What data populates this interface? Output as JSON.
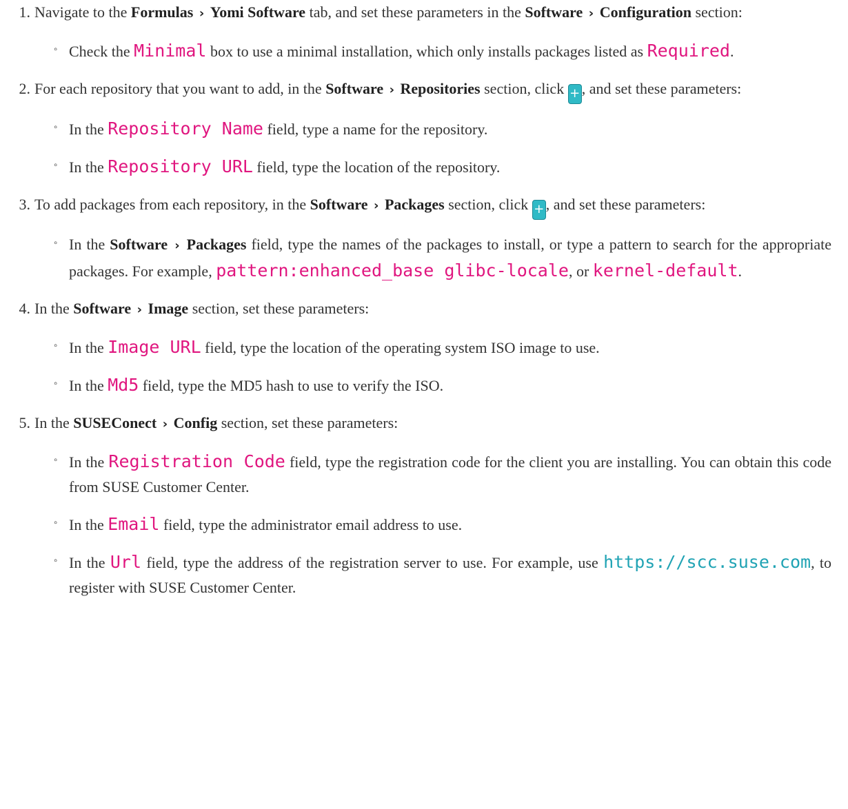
{
  "steps": [
    {
      "num": "1.",
      "t1": "Navigate to the",
      "b1": "Formulas",
      "b2": "Yomi Software",
      "t2": "tab, and set these parameters in the",
      "b3": "Software",
      "b4": "Configuration",
      "t3": "section:",
      "subs": [
        {
          "t1": "Check the",
          "code1": "Minimal",
          "t2": "box to use a minimal installation, which only installs packages listed as",
          "code2": "Required",
          "t3": "."
        }
      ]
    },
    {
      "num": "2.",
      "t1": "For each repository that you want to add, in the",
      "b1": "Software",
      "b2": "Repositories",
      "t2": "section, click",
      "plus": "+",
      "t3": ", and set these parameters:",
      "subs": [
        {
          "t1": "In the",
          "code1": "Repository Name",
          "t2": "field, type a name for the repository."
        },
        {
          "t1": "In the",
          "code1": "Repository URL",
          "t2": "field, type the location of the repository."
        }
      ]
    },
    {
      "num": "3.",
      "t1": "To add packages from each repository, in the",
      "b1": "Software",
      "b2": "Packages",
      "t2": "section, click",
      "plus": "+",
      "t3": ", and set these parameters:",
      "subs": [
        {
          "t1": "In the",
          "b1": "Software",
          "b2": "Packages",
          "t2": "field, type the names of the packages to install, or type a pattern to search for the appropriate packages. For example,",
          "code1": "pattern:enhanced_base glibc-locale",
          "t3": ", or",
          "code2": "kernel-default",
          "t4": "."
        }
      ]
    },
    {
      "num": "4.",
      "t1": "In the",
      "b1": "Software",
      "b2": "Image",
      "t2": "section, set these parameters:",
      "subs": [
        {
          "t1": "In the",
          "code1": "Image URL",
          "t2": "field, type the location of the operating system ISO image to use."
        },
        {
          "t1": "In the",
          "code1": "Md5",
          "t2": "field, type the MD5 hash to use to verify the ISO."
        }
      ]
    },
    {
      "num": "5.",
      "t1": "In the",
      "b1": "SUSEConect",
      "b2": "Config",
      "t2": "section, set these parameters:",
      "subs": [
        {
          "t1": "In the",
          "code1": "Registration Code",
          "t2": "field, type the registration code for the client you are installing. You can obtain this code from SUSE Customer Center."
        },
        {
          "t1": "In the",
          "code1": "Email",
          "t2": "field, type the administrator email address to use."
        },
        {
          "t1": "In the",
          "code1": "Url",
          "t2": "field, type the address of the registration server to use. For example, use",
          "link": "https://scc.suse.com",
          "t3": ", to register with SUSE Customer Center."
        }
      ]
    }
  ],
  "separator": "›",
  "bullet": "◦",
  "colors": {
    "code": "#e0167f",
    "link": "#20a3b4",
    "button": "#30bac6"
  }
}
